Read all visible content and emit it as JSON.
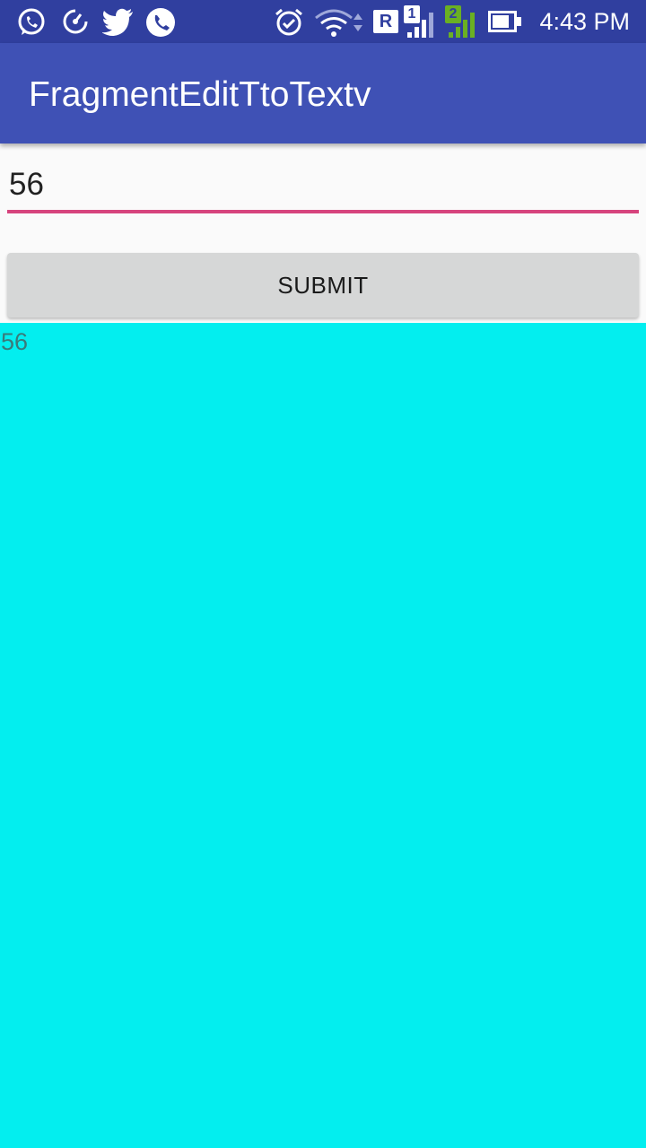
{
  "status_bar": {
    "time": "4:43 PM",
    "icons": [
      "whatsapp-icon",
      "data-saver-icon",
      "twitter-icon",
      "phone-icon",
      "alarm-icon",
      "wifi-icon",
      "roaming-icon",
      "sim1-signal-icon",
      "sim2-signal-icon",
      "battery-icon"
    ],
    "sim1_label": "1",
    "sim2_label": "2",
    "roaming_label": "R"
  },
  "app_bar": {
    "title": "FragmentEditTtoTextv",
    "color": "#3f51b5"
  },
  "form": {
    "input_value": "56",
    "underline_color": "#d6447d",
    "submit_label": "SUBMIT"
  },
  "fragment": {
    "background": "#03eeef",
    "output_text": "56"
  }
}
